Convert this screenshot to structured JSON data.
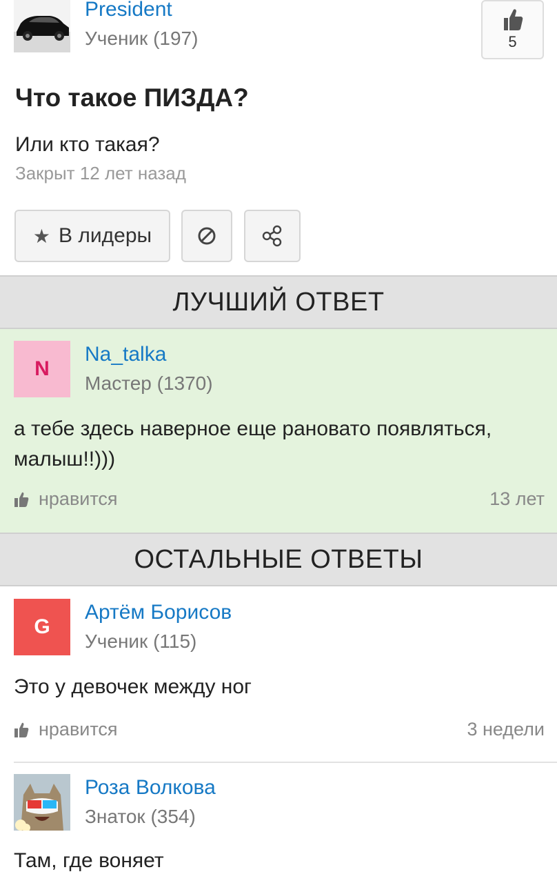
{
  "question": {
    "author": {
      "name": "President",
      "rank": "Ученик (197)"
    },
    "likes": "5",
    "title": "Что такое ПИЗДА?",
    "body": "Или кто такая?",
    "status": "Закрыт 12 лет назад",
    "actions": {
      "leaders_label": "В лидеры",
      "star_icon": "★"
    }
  },
  "best_answer": {
    "header": "ЛУЧШИЙ ОТВЕТ",
    "author": {
      "name": "Na_talka",
      "rank": "Мастер (1370)",
      "initial": "N",
      "avatar_bg": "#f8bad0",
      "avatar_fg": "#d81b60"
    },
    "text": "а тебе здесь наверное еще рановато появляться, малыш!!)))",
    "like_label": "нравится",
    "time": "13 лет"
  },
  "other_answers": {
    "header": "ОСТАЛЬНЫЕ ОТВЕТЫ",
    "items": [
      {
        "author": {
          "name": "Артём Борисов",
          "rank": "Ученик (115)",
          "initial": "G",
          "avatar_bg": "#ef5350",
          "avatar_fg": "#ffffff"
        },
        "text": "Это у девочек между ног",
        "like_label": "нравится",
        "time": "3 недели"
      },
      {
        "author": {
          "name": "Роза Волкова",
          "rank": "Знаток (354)"
        },
        "text": "Там, где воняет"
      }
    ]
  },
  "colors": {
    "link": "#1679c5",
    "best_bg": "#e4f3dd",
    "section_bg": "#e2e2e2"
  }
}
